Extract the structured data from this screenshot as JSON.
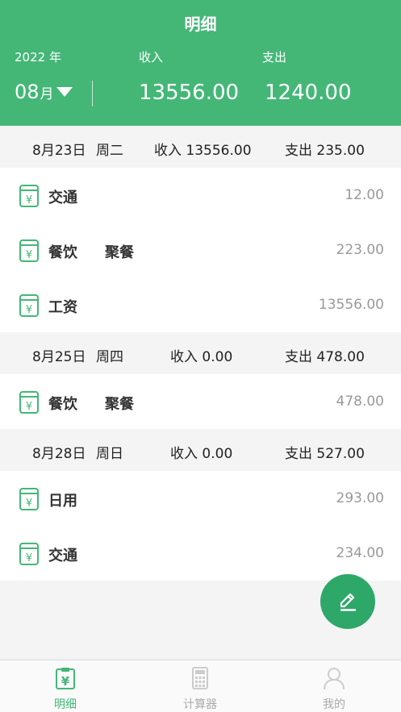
{
  "header": {
    "title": "明细",
    "year_label": "2022 年",
    "income_label": "收入",
    "expense_label": "支出",
    "month_value": "08",
    "month_unit": "月",
    "income_total": "13556.00",
    "expense_total": "1240.00"
  },
  "days": [
    {
      "date": "8月23日",
      "weekday": "周二",
      "income": "收入 13556.00",
      "expense": "支出 235.00",
      "items": [
        {
          "category": "交通",
          "note": "",
          "amount": "12.00"
        },
        {
          "category": "餐饮",
          "note": "聚餐",
          "amount": "223.00"
        },
        {
          "category": "工资",
          "note": "",
          "amount": "13556.00"
        }
      ]
    },
    {
      "date": "8月25日",
      "weekday": "周四",
      "income": "收入 0.00",
      "expense": "支出 478.00",
      "items": [
        {
          "category": "餐饮",
          "note": "聚餐",
          "amount": "478.00"
        }
      ]
    },
    {
      "date": "8月28日",
      "weekday": "周日",
      "income": "收入 0.00",
      "expense": "支出 527.00",
      "items": [
        {
          "category": "日用",
          "note": "",
          "amount": "293.00"
        },
        {
          "category": "交通",
          "note": "",
          "amount": "234.00"
        }
      ]
    }
  ],
  "tabs": [
    {
      "label": "明细",
      "icon": "ledger-icon",
      "active": true
    },
    {
      "label": "计算器",
      "icon": "calculator-icon",
      "active": false
    },
    {
      "label": "我的",
      "icon": "user-icon",
      "active": false
    }
  ],
  "colors": {
    "accent": "#44b777",
    "fab": "#2ea868",
    "item_icon": "#44b777",
    "tab_inactive": "#cccccc"
  }
}
